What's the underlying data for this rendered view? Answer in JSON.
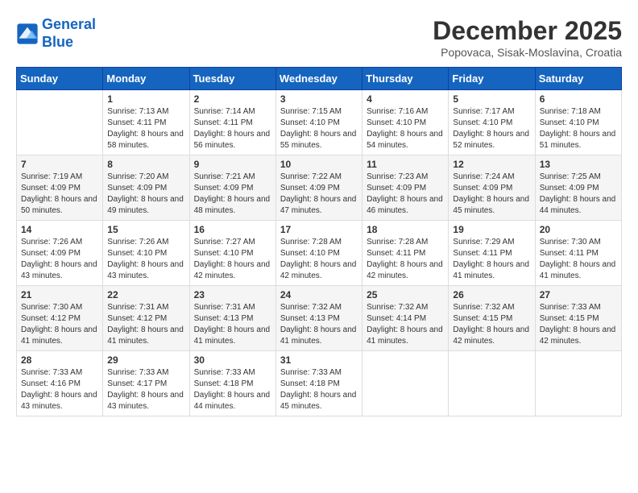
{
  "header": {
    "logo_line1": "General",
    "logo_line2": "Blue",
    "month": "December 2025",
    "location": "Popovaca, Sisak-Moslavina, Croatia"
  },
  "days_of_week": [
    "Sunday",
    "Monday",
    "Tuesday",
    "Wednesday",
    "Thursday",
    "Friday",
    "Saturday"
  ],
  "weeks": [
    [
      {
        "day": "",
        "sunrise": "",
        "sunset": "",
        "daylight": ""
      },
      {
        "day": "1",
        "sunrise": "Sunrise: 7:13 AM",
        "sunset": "Sunset: 4:11 PM",
        "daylight": "Daylight: 8 hours and 58 minutes."
      },
      {
        "day": "2",
        "sunrise": "Sunrise: 7:14 AM",
        "sunset": "Sunset: 4:11 PM",
        "daylight": "Daylight: 8 hours and 56 minutes."
      },
      {
        "day": "3",
        "sunrise": "Sunrise: 7:15 AM",
        "sunset": "Sunset: 4:10 PM",
        "daylight": "Daylight: 8 hours and 55 minutes."
      },
      {
        "day": "4",
        "sunrise": "Sunrise: 7:16 AM",
        "sunset": "Sunset: 4:10 PM",
        "daylight": "Daylight: 8 hours and 54 minutes."
      },
      {
        "day": "5",
        "sunrise": "Sunrise: 7:17 AM",
        "sunset": "Sunset: 4:10 PM",
        "daylight": "Daylight: 8 hours and 52 minutes."
      },
      {
        "day": "6",
        "sunrise": "Sunrise: 7:18 AM",
        "sunset": "Sunset: 4:10 PM",
        "daylight": "Daylight: 8 hours and 51 minutes."
      }
    ],
    [
      {
        "day": "7",
        "sunrise": "Sunrise: 7:19 AM",
        "sunset": "Sunset: 4:09 PM",
        "daylight": "Daylight: 8 hours and 50 minutes."
      },
      {
        "day": "8",
        "sunrise": "Sunrise: 7:20 AM",
        "sunset": "Sunset: 4:09 PM",
        "daylight": "Daylight: 8 hours and 49 minutes."
      },
      {
        "day": "9",
        "sunrise": "Sunrise: 7:21 AM",
        "sunset": "Sunset: 4:09 PM",
        "daylight": "Daylight: 8 hours and 48 minutes."
      },
      {
        "day": "10",
        "sunrise": "Sunrise: 7:22 AM",
        "sunset": "Sunset: 4:09 PM",
        "daylight": "Daylight: 8 hours and 47 minutes."
      },
      {
        "day": "11",
        "sunrise": "Sunrise: 7:23 AM",
        "sunset": "Sunset: 4:09 PM",
        "daylight": "Daylight: 8 hours and 46 minutes."
      },
      {
        "day": "12",
        "sunrise": "Sunrise: 7:24 AM",
        "sunset": "Sunset: 4:09 PM",
        "daylight": "Daylight: 8 hours and 45 minutes."
      },
      {
        "day": "13",
        "sunrise": "Sunrise: 7:25 AM",
        "sunset": "Sunset: 4:09 PM",
        "daylight": "Daylight: 8 hours and 44 minutes."
      }
    ],
    [
      {
        "day": "14",
        "sunrise": "Sunrise: 7:26 AM",
        "sunset": "Sunset: 4:09 PM",
        "daylight": "Daylight: 8 hours and 43 minutes."
      },
      {
        "day": "15",
        "sunrise": "Sunrise: 7:26 AM",
        "sunset": "Sunset: 4:10 PM",
        "daylight": "Daylight: 8 hours and 43 minutes."
      },
      {
        "day": "16",
        "sunrise": "Sunrise: 7:27 AM",
        "sunset": "Sunset: 4:10 PM",
        "daylight": "Daylight: 8 hours and 42 minutes."
      },
      {
        "day": "17",
        "sunrise": "Sunrise: 7:28 AM",
        "sunset": "Sunset: 4:10 PM",
        "daylight": "Daylight: 8 hours and 42 minutes."
      },
      {
        "day": "18",
        "sunrise": "Sunrise: 7:28 AM",
        "sunset": "Sunset: 4:11 PM",
        "daylight": "Daylight: 8 hours and 42 minutes."
      },
      {
        "day": "19",
        "sunrise": "Sunrise: 7:29 AM",
        "sunset": "Sunset: 4:11 PM",
        "daylight": "Daylight: 8 hours and 41 minutes."
      },
      {
        "day": "20",
        "sunrise": "Sunrise: 7:30 AM",
        "sunset": "Sunset: 4:11 PM",
        "daylight": "Daylight: 8 hours and 41 minutes."
      }
    ],
    [
      {
        "day": "21",
        "sunrise": "Sunrise: 7:30 AM",
        "sunset": "Sunset: 4:12 PM",
        "daylight": "Daylight: 8 hours and 41 minutes."
      },
      {
        "day": "22",
        "sunrise": "Sunrise: 7:31 AM",
        "sunset": "Sunset: 4:12 PM",
        "daylight": "Daylight: 8 hours and 41 minutes."
      },
      {
        "day": "23",
        "sunrise": "Sunrise: 7:31 AM",
        "sunset": "Sunset: 4:13 PM",
        "daylight": "Daylight: 8 hours and 41 minutes."
      },
      {
        "day": "24",
        "sunrise": "Sunrise: 7:32 AM",
        "sunset": "Sunset: 4:13 PM",
        "daylight": "Daylight: 8 hours and 41 minutes."
      },
      {
        "day": "25",
        "sunrise": "Sunrise: 7:32 AM",
        "sunset": "Sunset: 4:14 PM",
        "daylight": "Daylight: 8 hours and 41 minutes."
      },
      {
        "day": "26",
        "sunrise": "Sunrise: 7:32 AM",
        "sunset": "Sunset: 4:15 PM",
        "daylight": "Daylight: 8 hours and 42 minutes."
      },
      {
        "day": "27",
        "sunrise": "Sunrise: 7:33 AM",
        "sunset": "Sunset: 4:15 PM",
        "daylight": "Daylight: 8 hours and 42 minutes."
      }
    ],
    [
      {
        "day": "28",
        "sunrise": "Sunrise: 7:33 AM",
        "sunset": "Sunset: 4:16 PM",
        "daylight": "Daylight: 8 hours and 43 minutes."
      },
      {
        "day": "29",
        "sunrise": "Sunrise: 7:33 AM",
        "sunset": "Sunset: 4:17 PM",
        "daylight": "Daylight: 8 hours and 43 minutes."
      },
      {
        "day": "30",
        "sunrise": "Sunrise: 7:33 AM",
        "sunset": "Sunset: 4:18 PM",
        "daylight": "Daylight: 8 hours and 44 minutes."
      },
      {
        "day": "31",
        "sunrise": "Sunrise: 7:33 AM",
        "sunset": "Sunset: 4:18 PM",
        "daylight": "Daylight: 8 hours and 45 minutes."
      },
      {
        "day": "",
        "sunrise": "",
        "sunset": "",
        "daylight": ""
      },
      {
        "day": "",
        "sunrise": "",
        "sunset": "",
        "daylight": ""
      },
      {
        "day": "",
        "sunrise": "",
        "sunset": "",
        "daylight": ""
      }
    ]
  ]
}
